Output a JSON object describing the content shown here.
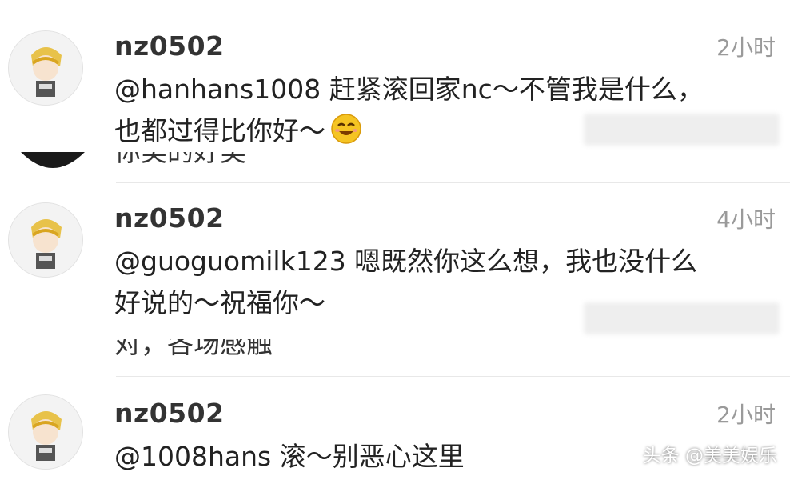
{
  "comments": [
    {
      "username": "nz0502",
      "time": "2小时",
      "text_line1": "@hanhans1008 赶紧滚回家nc～不管我是什么，",
      "text_line2": "也都过得比你好～",
      "emoji": "smile-emoji-icon"
    },
    {
      "username": "nz0502",
      "time": "4小时",
      "text_line1": "@guoguomilk123 嗯既然你这么想，我也没什么",
      "text_line2": "好说的～祝福你～"
    },
    {
      "username": "nz0502",
      "time": "2小时",
      "text_line1": "@1008hans 滚～别恶心这里"
    }
  ],
  "fragments": {
    "first": "你美的好美",
    "second": "对，各场感触"
  },
  "watermark": "头条 @美美娱乐",
  "colors": {
    "text": "#222222",
    "username": "#333333",
    "time": "#9a9a9a",
    "divider": "#e8e8e8"
  }
}
